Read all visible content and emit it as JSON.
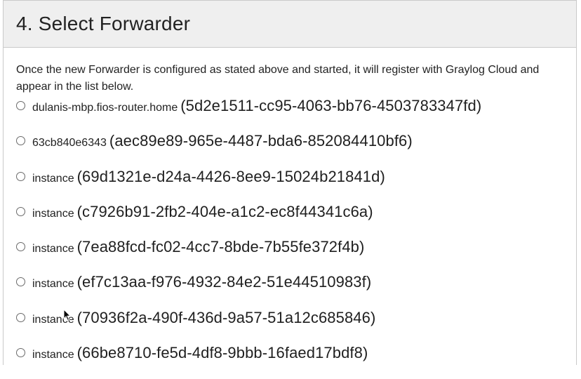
{
  "panel": {
    "title": "4. Select Forwarder",
    "description": "Once the new Forwarder is configured as stated above and started, it will register with Graylog Cloud and appear in the list below."
  },
  "forwarders": [
    {
      "host": "dulanis-mbp.fios-router.home",
      "id": "(5d2e1511-cc95-4063-bb76-4503783347fd)"
    },
    {
      "host": "63cb840e6343",
      "id": "(aec89e89-965e-4487-bda6-852084410bf6)"
    },
    {
      "host": "instance",
      "id": "(69d1321e-d24a-4426-8ee9-15024b21841d)"
    },
    {
      "host": "instance",
      "id": "(c7926b91-2fb2-404e-a1c2-ec8f44341c6a)"
    },
    {
      "host": "instance",
      "id": "(7ea88fcd-fc02-4cc7-8bde-7b55fe372f4b)"
    },
    {
      "host": "instance",
      "id": "(ef7c13aa-f976-4932-84e2-51e44510983f)"
    },
    {
      "host": "instance",
      "id": "(70936f2a-490f-436d-9a57-51a12c685846)"
    },
    {
      "host": "instance",
      "id": "(66be8710-fe5d-4df8-9bbb-16faed17bdf8)"
    }
  ]
}
